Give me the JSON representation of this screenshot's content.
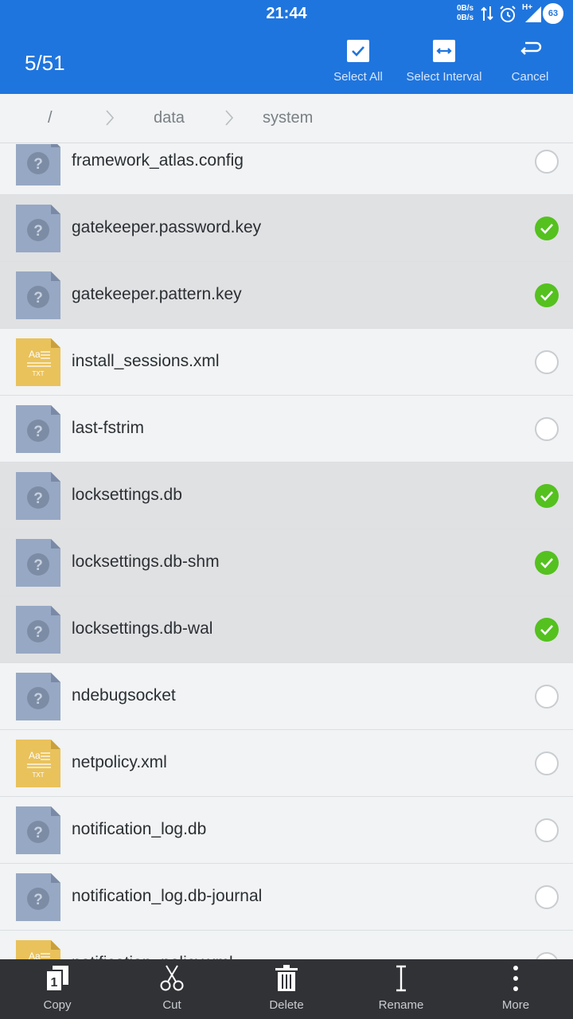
{
  "status_bar": {
    "time": "21:44",
    "net_up": "0B/s",
    "net_down": "0B/s",
    "network_type": "H+",
    "battery": "63"
  },
  "top_bar": {
    "selection_count": "5/51",
    "actions": [
      {
        "label": "Select All",
        "icon": "checkbox-icon"
      },
      {
        "label": "Select Interval",
        "icon": "interval-arrows-icon"
      },
      {
        "label": "Cancel",
        "icon": "return-arrow-icon"
      }
    ]
  },
  "breadcrumb": {
    "items": [
      "/",
      "data",
      "system"
    ]
  },
  "files": [
    {
      "name": "framework_atlas.config",
      "type": "unknown",
      "selected": false
    },
    {
      "name": "gatekeeper.password.key",
      "type": "unknown",
      "selected": true
    },
    {
      "name": "gatekeeper.pattern.key",
      "type": "unknown",
      "selected": true
    },
    {
      "name": "install_sessions.xml",
      "type": "txt",
      "selected": false
    },
    {
      "name": "last-fstrim",
      "type": "unknown",
      "selected": false
    },
    {
      "name": "locksettings.db",
      "type": "unknown",
      "selected": true
    },
    {
      "name": "locksettings.db-shm",
      "type": "unknown",
      "selected": true
    },
    {
      "name": "locksettings.db-wal",
      "type": "unknown",
      "selected": true
    },
    {
      "name": "ndebugsocket",
      "type": "unknown",
      "selected": false
    },
    {
      "name": "netpolicy.xml",
      "type": "txt",
      "selected": false
    },
    {
      "name": "notification_log.db",
      "type": "unknown",
      "selected": false
    },
    {
      "name": "notification_log.db-journal",
      "type": "unknown",
      "selected": false
    },
    {
      "name": "notification_policy.xml",
      "type": "txt",
      "selected": false
    }
  ],
  "file_icon_text": {
    "txt_top": "Aa",
    "txt_bottom": "TXT",
    "unknown": "?"
  },
  "bottom_bar": {
    "items": [
      {
        "label": "Copy",
        "icon": "copy-icon"
      },
      {
        "label": "Cut",
        "icon": "scissors-icon"
      },
      {
        "label": "Delete",
        "icon": "trash-icon"
      },
      {
        "label": "Rename",
        "icon": "text-cursor-icon"
      },
      {
        "label": "More",
        "icon": "more-vertical-icon"
      }
    ]
  },
  "colors": {
    "accent": "#1f75de",
    "selected_check": "#54c11f",
    "unknown_file": "#97a8c4",
    "txt_file": "#e9c25c",
    "toolbar_dark": "#303236"
  }
}
